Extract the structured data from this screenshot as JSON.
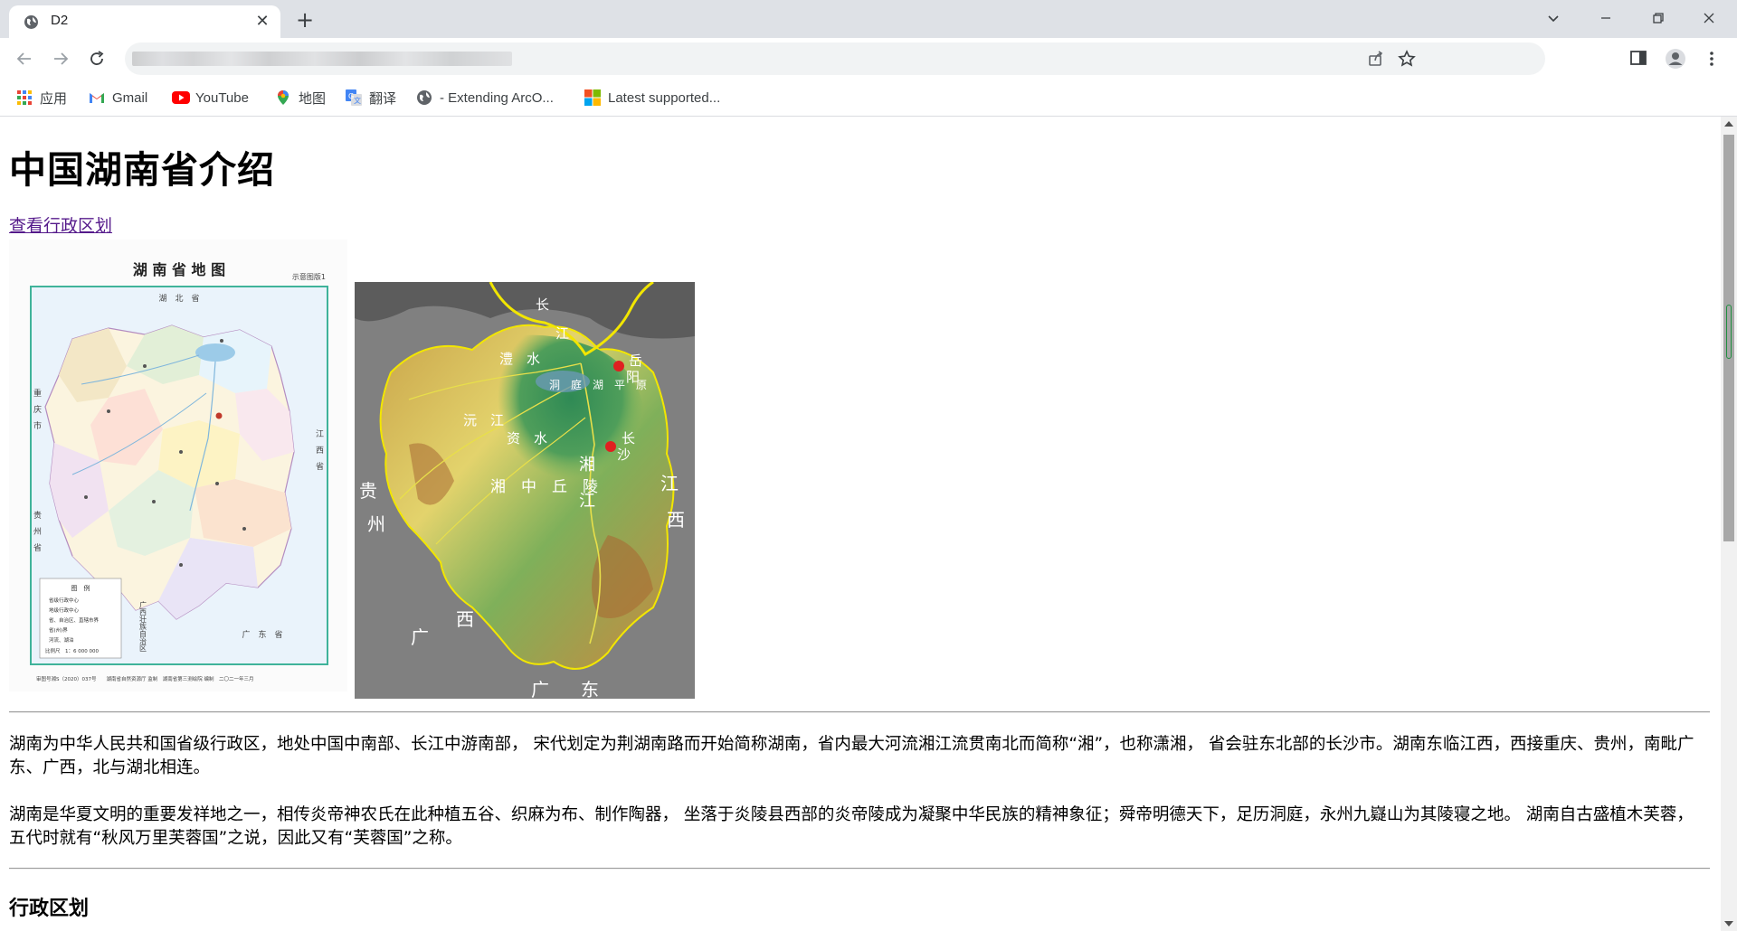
{
  "browser": {
    "tab_title": "D2",
    "bookmarks": [
      {
        "label": "应用",
        "icon": "apps-grid-icon"
      },
      {
        "label": "Gmail",
        "icon": "gmail-icon"
      },
      {
        "label": "YouTube",
        "icon": "youtube-icon"
      },
      {
        "label": "地图",
        "icon": "maps-pin-icon"
      },
      {
        "label": "翻译",
        "icon": "translate-icon"
      },
      {
        "label": "- Extending ArcO...",
        "icon": "globe-icon"
      },
      {
        "label": "Latest supported...",
        "icon": "windows-icon"
      }
    ]
  },
  "page": {
    "title": "中国湖南省介绍",
    "link_label": "查看行政区划",
    "paragraphs": [
      "湖南为中华人民共和国省级行政区，地处中国中南部、长江中游南部， 宋代划定为荆湖南路而开始简称湖南，省内最大河流湘江流贯南北而简称“湘”，也称潇湘， 省会驻东北部的长沙市。湖南东临江西，西接重庆、贵州，南毗广东、广西，北与湖北相连。",
      "湖南是华夏文明的重要发祥地之一，相传炎帝神农氏在此种植五谷、织麻为布、制作陶器， 坐落于炎陵县西部的炎帝陵成为凝聚中华民族的精神象征；舜帝明德天下，足历洞庭，永州九嶷山为其陵寝之地。 湖南自古盛植木芙蓉，五代时就有“秋风万里芙蓉国”之说，因此又有“芙蓉国”之称。"
    ],
    "section_heading": "行政区划",
    "map1": {
      "title": "湖 南 省 地 图",
      "subtitle": "示意图版1",
      "border_top": "湖　北　省",
      "border_left": "重　庆　市",
      "border_left2": "贵　州　省",
      "border_right": "江　西　省",
      "border_bottom_left": "广西壮族自治区",
      "border_bottom": "广　东　省",
      "legend_title": "图　例",
      "legend_items": [
        "省级行政中心",
        "地级行政中心",
        "省、自治区、直辖市界",
        "省(州)界",
        "河流、湖泊"
      ],
      "scale": "比例尺　1：6 000 000",
      "footer": "审图号湘S（2020）037号　　湖南省自然资源厅 监制　湖南省第三测绘院 编制　二〇二一年三月"
    },
    "map2": {
      "labels": [
        "长",
        "江",
        "澧　水",
        "洞　庭　湖　平　原",
        "岳",
        "阳",
        "沅　江",
        "资　水",
        "长",
        "沙",
        "湘",
        "江",
        "湘　中　丘　陵",
        "贵",
        "州",
        "江",
        "西",
        "广",
        "西",
        "广",
        "东"
      ]
    }
  }
}
